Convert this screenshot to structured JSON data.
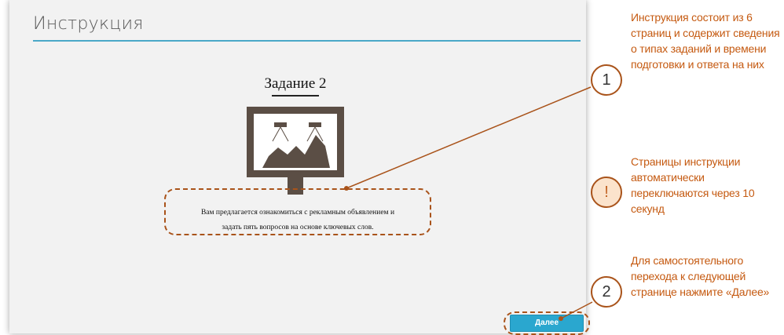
{
  "screen": {
    "title": "Инструкция",
    "task_heading": "Задание 2",
    "description_line1": "Вам предлагается ознакомиться с рекламным объявлением и",
    "description_line2": "задать пять вопросов на основе ключевых слов.",
    "next_button": "Далее"
  },
  "annotations": [
    {
      "marker": "1",
      "text": "Инструкция состоит из 6 страниц и содержит сведения о типах заданий и времени подготовки и ответа на них"
    },
    {
      "marker": "!",
      "text": "Страницы инструкции автоматически переключаются через 10 секунд"
    },
    {
      "marker": "2",
      "text": "Для самостоятельного перехода к следующей странице нажмите «Далее»"
    }
  ],
  "colors": {
    "accent": "#4aa8c8",
    "button": "#2aa7cf",
    "annotation": "#c55a11",
    "screen_bg": "#f2f2f2"
  },
  "icons": {
    "illustration": "billboard-icon"
  }
}
